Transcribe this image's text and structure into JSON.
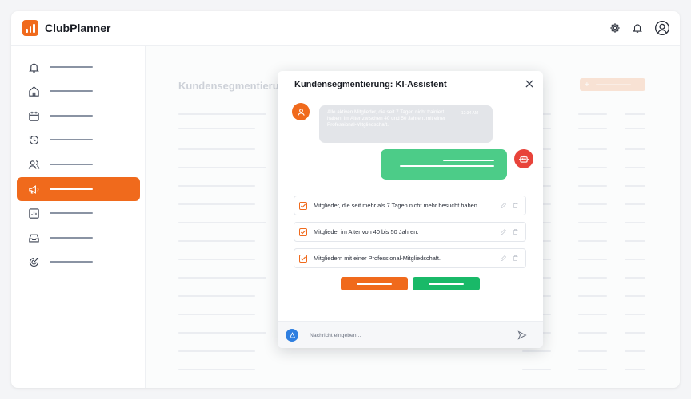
{
  "app": {
    "name": "ClubPlanner"
  },
  "header": {
    "icons": [
      "settings-icon",
      "bell-icon",
      "user-icon"
    ]
  },
  "sidebar": {
    "items": [
      {
        "icon": "bell-icon",
        "active": false
      },
      {
        "icon": "home-icon",
        "active": false
      },
      {
        "icon": "calendar-icon",
        "active": false
      },
      {
        "icon": "history-icon",
        "active": false
      },
      {
        "icon": "users-icon",
        "active": false
      },
      {
        "icon": "megaphone-icon",
        "active": true
      },
      {
        "icon": "chart-icon",
        "active": false
      },
      {
        "icon": "inbox-icon",
        "active": false
      },
      {
        "icon": "target-icon",
        "active": false
      }
    ]
  },
  "page": {
    "title": "Kundensegmentierung"
  },
  "modal": {
    "title": "Kundensegmentierung: KI-Assistent",
    "user_message": "Alle aktiven Mitglieder, die seit 7 Tagen nicht trainiert haben, im Alter zwischen 40 und 50 Jahren, mit einer Professional-Mitgliedschaft.",
    "user_time": "12:34 AM",
    "criteria": [
      {
        "label": "Mitglieder, die seit mehr als 7 Tagen nicht mehr besucht haben.",
        "checked": true
      },
      {
        "label": "Mitglieder im Alter von 40 bis 50 Jahren.",
        "checked": true
      },
      {
        "label": "Mitgliedern mit einer Professional-Mitgliedschaft.",
        "checked": true
      }
    ],
    "composer": {
      "placeholder": "Nachricht eingeben..."
    }
  },
  "colors": {
    "accent": "#f06a1c",
    "success": "#19b968",
    "bot_bubble": "#4ccc88",
    "bot_avatar": "#e8433a",
    "user_avatar": "#2f7fe0"
  }
}
